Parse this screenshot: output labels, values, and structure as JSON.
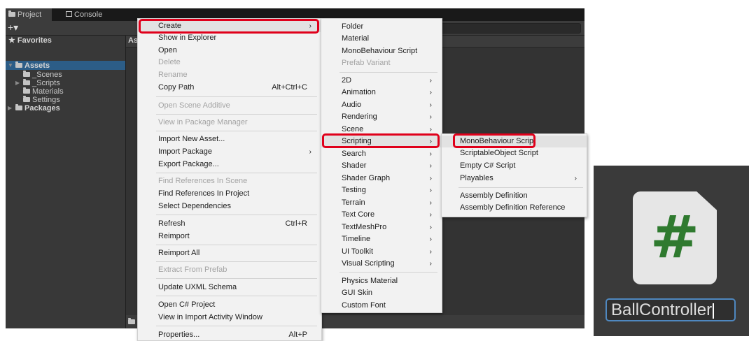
{
  "editor": {
    "tabs": [
      "Project",
      "Console"
    ],
    "toolbar": {
      "add_label": "+▾"
    },
    "breadcrumb": "As",
    "tree": {
      "favorites": "Favorites",
      "assets": "Assets",
      "children": [
        "_Scenes",
        "_Scripts",
        "Materials",
        "Settings"
      ],
      "packages": "Packages"
    }
  },
  "context_menu": {
    "items": [
      {
        "label": "Create",
        "submenu": true
      },
      {
        "label": "Show in Explorer"
      },
      {
        "label": "Open"
      },
      {
        "label": "Delete",
        "disabled": true
      },
      {
        "label": "Rename",
        "disabled": true
      },
      {
        "label": "Copy Path",
        "shortcut": "Alt+Ctrl+C"
      },
      {
        "label": "Open Scene Additive",
        "disabled": true
      },
      {
        "label": "View in Package Manager",
        "disabled": true
      },
      {
        "label": "Import New Asset..."
      },
      {
        "label": "Import Package",
        "submenu": true
      },
      {
        "label": "Export Package..."
      },
      {
        "label": "Find References In Scene",
        "disabled": true
      },
      {
        "label": "Find References In Project"
      },
      {
        "label": "Select Dependencies"
      },
      {
        "label": "Refresh",
        "shortcut": "Ctrl+R"
      },
      {
        "label": "Reimport"
      },
      {
        "label": "Reimport All"
      },
      {
        "label": "Extract From Prefab",
        "disabled": true
      },
      {
        "label": "Update UXML Schema"
      },
      {
        "label": "Open C# Project"
      },
      {
        "label": "View in Import Activity Window"
      },
      {
        "label": "Properties...",
        "shortcut": "Alt+P"
      }
    ]
  },
  "create_menu": {
    "items": [
      {
        "label": "Folder"
      },
      {
        "label": "Material"
      },
      {
        "label": "MonoBehaviour Script"
      },
      {
        "label": "Prefab Variant",
        "disabled": true
      },
      {
        "label": "2D",
        "submenu": true
      },
      {
        "label": "Animation",
        "submenu": true
      },
      {
        "label": "Audio",
        "submenu": true
      },
      {
        "label": "Rendering",
        "submenu": true
      },
      {
        "label": "Scene",
        "submenu": true
      },
      {
        "label": "Scripting",
        "submenu": true
      },
      {
        "label": "Search",
        "submenu": true
      },
      {
        "label": "Shader",
        "submenu": true
      },
      {
        "label": "Shader Graph",
        "submenu": true
      },
      {
        "label": "Testing",
        "submenu": true
      },
      {
        "label": "Terrain",
        "submenu": true
      },
      {
        "label": "Text Core",
        "submenu": true
      },
      {
        "label": "TextMeshPro",
        "submenu": true
      },
      {
        "label": "Timeline",
        "submenu": true
      },
      {
        "label": "UI Toolkit",
        "submenu": true
      },
      {
        "label": "Visual Scripting",
        "submenu": true
      },
      {
        "label": "Physics Material"
      },
      {
        "label": "GUI Skin"
      },
      {
        "label": "Custom Font"
      }
    ]
  },
  "scripting_menu": {
    "items": [
      {
        "label": "MonoBehaviour Script"
      },
      {
        "label": "ScriptableObject Script"
      },
      {
        "label": "Empty C# Script"
      },
      {
        "label": "Playables",
        "submenu": true
      },
      {
        "label": "Assembly Definition"
      },
      {
        "label": "Assembly Definition Reference"
      }
    ]
  },
  "zoom_panel": {
    "icon_glyph": "#",
    "file_name": "BallController"
  },
  "colors": {
    "highlight_box": "#e0001b",
    "menu_bg": "#f2f2f2",
    "script_icon_green": "#2f7a2f",
    "rename_border": "#4f88c0"
  },
  "arrow_glyph": "›"
}
